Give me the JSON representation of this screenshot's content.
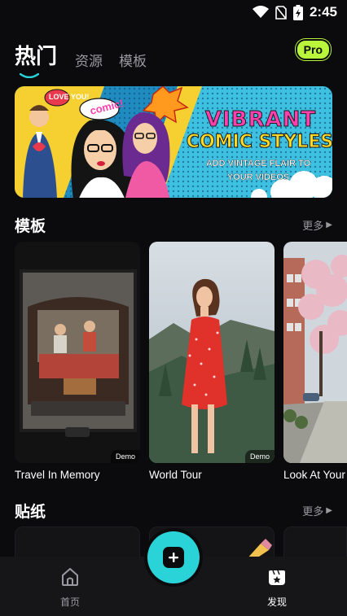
{
  "status": {
    "time": "2:45"
  },
  "tabs": [
    {
      "label": "热门",
      "active": true
    },
    {
      "label": "资源",
      "active": false
    },
    {
      "label": "模板",
      "active": false
    }
  ],
  "pro_badge": "Pro",
  "banner": {
    "bubble_love": "LOVE YOU!",
    "bubble_comic": "comic!",
    "title_line1": "VIBRANT",
    "title_line2": "COMIC STYLES",
    "subtitle_line1": "ADD VINTAGE FLAIR TO",
    "subtitle_line2": "YOUR VIDEOS"
  },
  "templates_section": {
    "title": "模板",
    "more": "更多",
    "items": [
      {
        "title": "Travel In Memory",
        "badge": "Demo"
      },
      {
        "title": "World Tour",
        "badge": "Demo"
      },
      {
        "title": "Look At Your"
      }
    ]
  },
  "stickers_section": {
    "title": "贴纸",
    "more": "更多"
  },
  "bottom_nav": {
    "home": "首页",
    "discover": "发现"
  },
  "colors": {
    "background": "#0b0b0d",
    "pro_badge": "#b9f53b",
    "fab": "#2ad3d8",
    "accent_pink": "#ff3fae",
    "accent_yellow": "#ffd927"
  }
}
